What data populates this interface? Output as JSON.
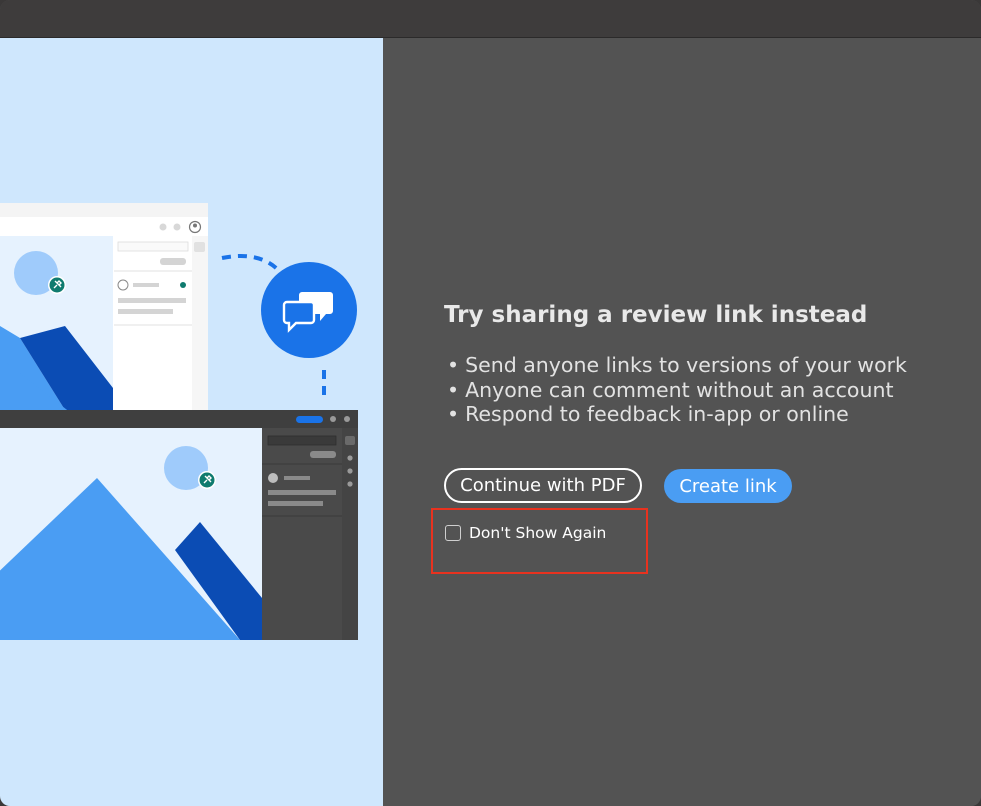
{
  "dialog": {
    "heading": "Try sharing a review link instead",
    "bullets": [
      "Send anyone links to versions of your work",
      "Anyone can comment without an account",
      "Respond to feedback in-app or online"
    ],
    "continue_button": "Continue with PDF",
    "create_link_button": "Create link",
    "dont_show_again": "Don't Show Again",
    "dont_show_again_checked": false
  },
  "illustration": {
    "icons": [
      "pin-icon",
      "comment-bubbles-icon",
      "avatar-icon",
      "mountain-image"
    ]
  },
  "colors": {
    "accent": "#4a9df3",
    "panel_bg": "#535353",
    "illustration_bg": "#cfe7fd",
    "highlight": "#e8321f",
    "chat_circle": "#1a73e8"
  }
}
